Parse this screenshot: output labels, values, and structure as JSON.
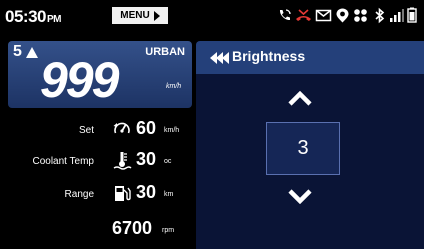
{
  "status_bar": {
    "time": "05:30",
    "ampm": "PM",
    "menu_label": "MENU",
    "icons": [
      "phone-icon",
      "missed-call-icon",
      "message-icon",
      "navigation-icon",
      "connected-icon",
      "bluetooth-icon",
      "signal-icon",
      "battery-icon"
    ]
  },
  "speed_card": {
    "gear": "5",
    "mode": "URBAN",
    "speed": "999",
    "speed_unit": "km/h"
  },
  "info": {
    "set_label": "Set",
    "set_value": "60",
    "set_unit": "km/h",
    "coolant_label": "Coolant Temp",
    "coolant_value": "30",
    "coolant_unit": "oc",
    "range_label": "Range",
    "range_value": "30",
    "range_unit": "km",
    "rpm_value": "6700",
    "rpm_unit": "rpm"
  },
  "brightness": {
    "title": "Brightness",
    "value": "3"
  },
  "colors": {
    "card_blue": "#2b4680",
    "panel_dark": "#0a1436",
    "header_blue": "#24407a",
    "missed_call_red": "#e53935"
  }
}
